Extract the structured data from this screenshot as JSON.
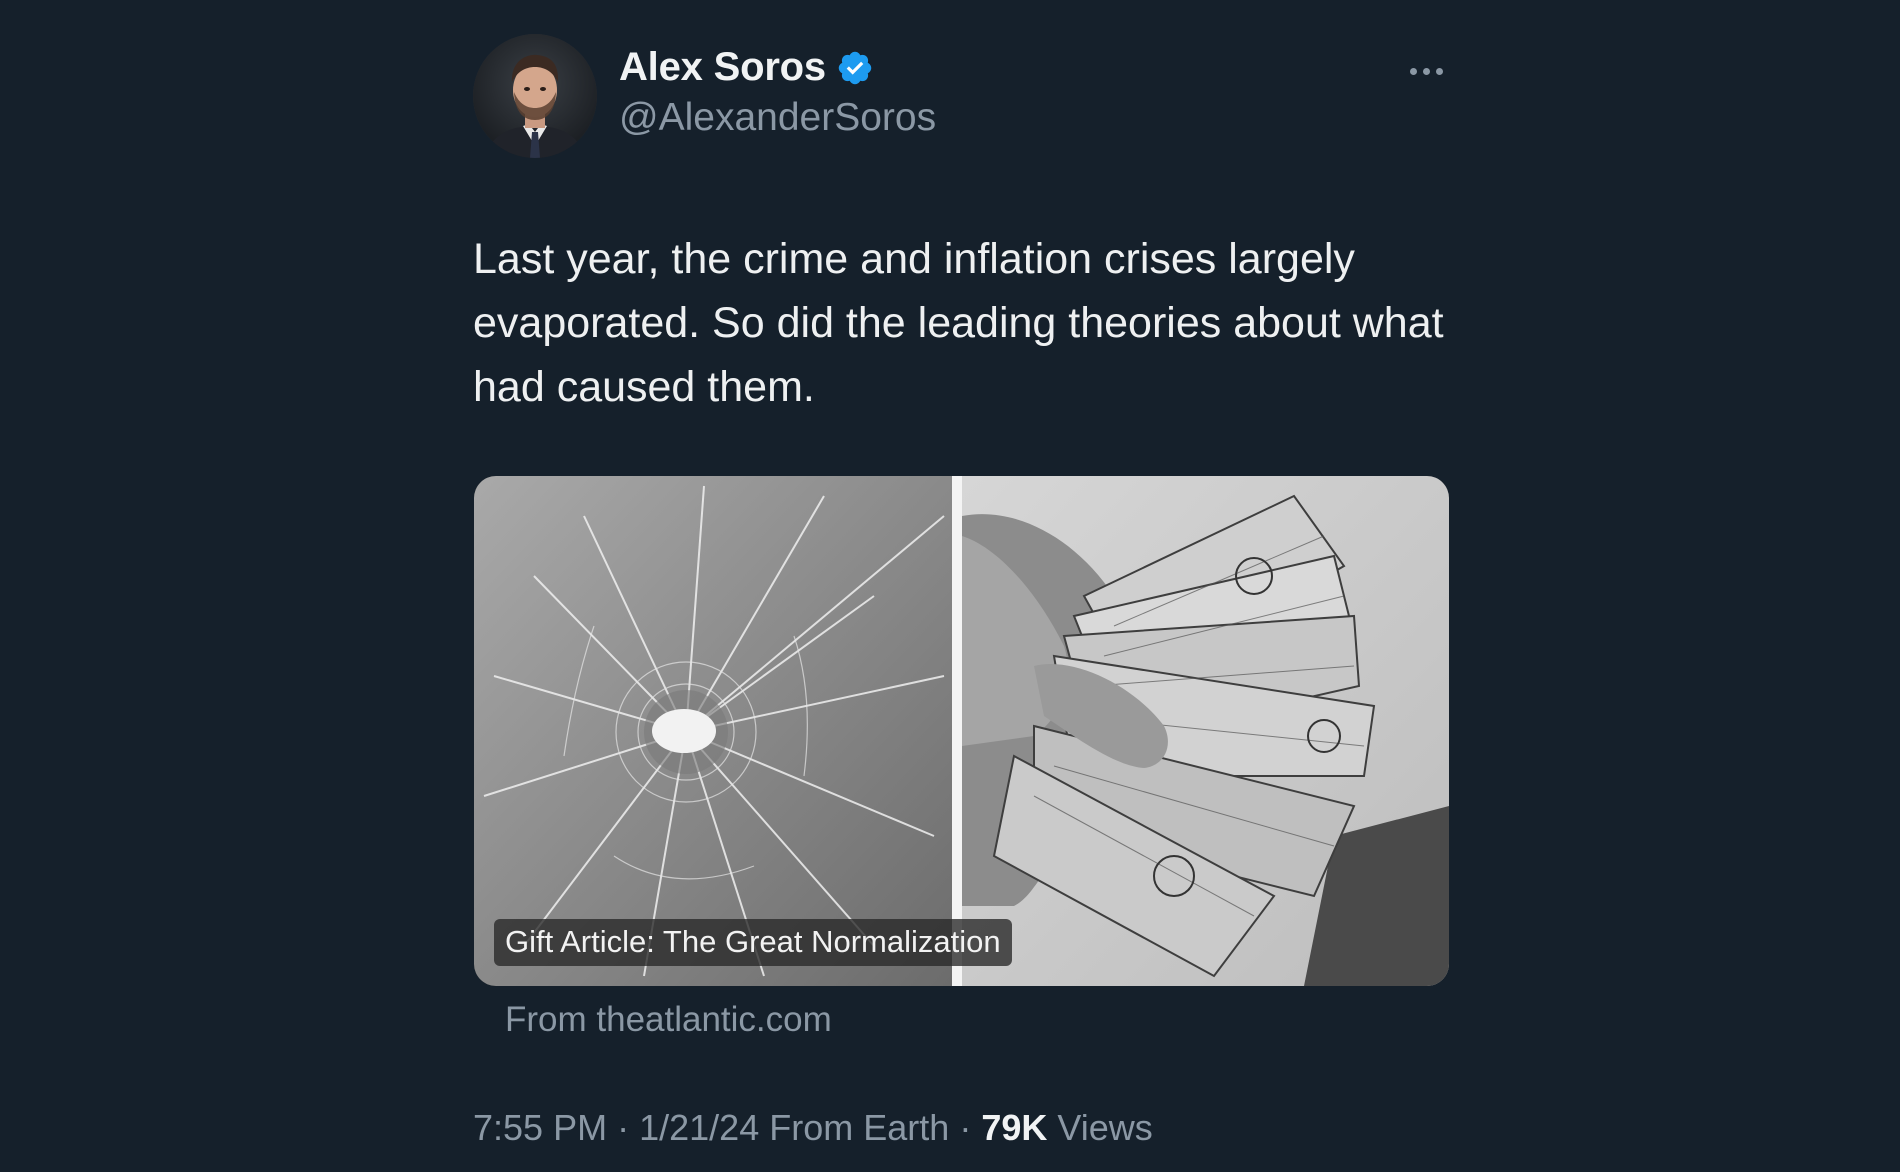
{
  "author": {
    "display_name": "Alex Soros",
    "handle": "@AlexanderSoros",
    "verified": true,
    "verified_color": "#1d9bf0"
  },
  "tweet": {
    "text": "Last year, the crime and inflation crises largely evaporated. So did the leading theories about what had caused them."
  },
  "card": {
    "caption": "Gift Article: The Great Normalization",
    "source": "From theatlantic.com"
  },
  "meta": {
    "time": "7:55 PM",
    "date": "1/21/24",
    "origin": "From Earth",
    "separator": "·",
    "views_count": "79K",
    "views_label": "Views"
  },
  "icons": {
    "verified": "verified-badge-icon",
    "more": "more-options-icon"
  },
  "colors": {
    "background": "#15202b",
    "text_primary": "#e7e9ea",
    "text_secondary": "#8b98a5"
  }
}
